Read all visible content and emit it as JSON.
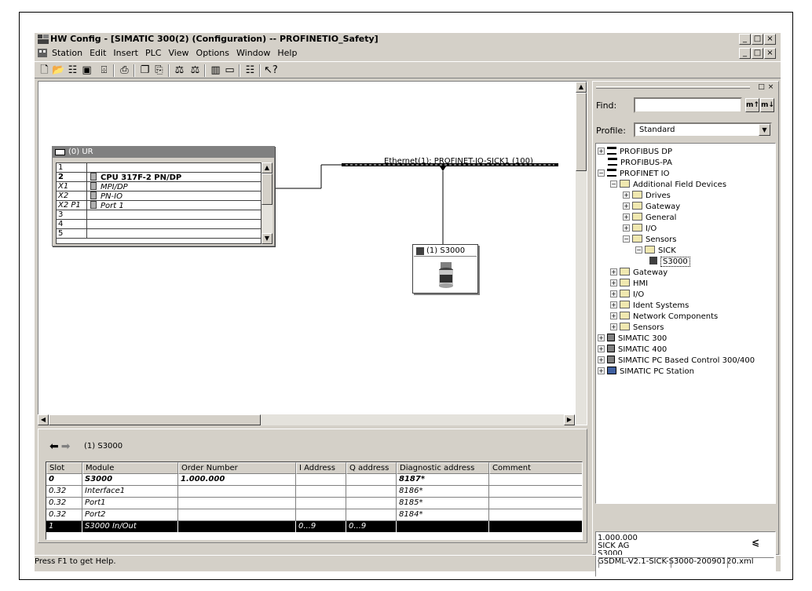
{
  "window": {
    "title": "HW Config - [SIMATIC 300(2) (Configuration) -- PROFINETIO_Safety]",
    "controls": [
      "_",
      "□",
      "×"
    ]
  },
  "menubar": [
    "Station",
    "Edit",
    "Insert",
    "PLC",
    "View",
    "Options",
    "Window",
    "Help"
  ],
  "toolbar": {
    "icons": [
      "new-icon",
      "open-icon",
      "save-compile-icon",
      "save-icon",
      "download-icon",
      "print-icon",
      "copy-icon",
      "paste-icon",
      "catalog-icon",
      "network-icon",
      "config-icon",
      "monitor-icon",
      "hardware-icon",
      "help-icon"
    ]
  },
  "rack": {
    "title": "(0) UR",
    "rows": [
      {
        "slot": "1",
        "module": "",
        "bold": false,
        "icon": false
      },
      {
        "slot": "2",
        "module": "CPU 317F-2 PN/DP",
        "bold": true,
        "icon": true
      },
      {
        "slot": "X1",
        "module": "MPI/DP",
        "bold": false,
        "icon": true
      },
      {
        "slot": "X2",
        "module": "PN-IO",
        "bold": false,
        "icon": true
      },
      {
        "slot": "X2 P1",
        "module": "Port 1",
        "bold": false,
        "icon": true
      },
      {
        "slot": "3",
        "module": "",
        "bold": false,
        "icon": false
      },
      {
        "slot": "4",
        "module": "",
        "bold": false,
        "icon": false
      },
      {
        "slot": "5",
        "module": "",
        "bold": false,
        "icon": false
      }
    ]
  },
  "network": {
    "label": "Ethernet(1): PROFINET-IO-SICK1 (100)"
  },
  "device": {
    "label": "(1) S3000"
  },
  "detail": {
    "title": "(1)   S3000",
    "columns": [
      "Slot",
      "Module",
      "Order Number",
      "I Address",
      "Q address",
      "Diagnostic address",
      "Comment"
    ],
    "rows": [
      {
        "slot": "0",
        "module": "S3000",
        "order": "1.000.000",
        "i": "",
        "q": "",
        "diag": "8187*",
        "comment": ""
      },
      {
        "slot": "0.32",
        "module": "Interface1",
        "order": "",
        "i": "",
        "q": "",
        "diag": "8186*",
        "comment": ""
      },
      {
        "slot": "0.32",
        "module": "Port1",
        "order": "",
        "i": "",
        "q": "",
        "diag": "8185*",
        "comment": ""
      },
      {
        "slot": "0.32",
        "module": "Port2",
        "order": "",
        "i": "",
        "q": "",
        "diag": "8184*",
        "comment": ""
      },
      {
        "slot": "1",
        "module": "S3000 In/Out",
        "order": "",
        "i": "0...9",
        "q": "0...9",
        "diag": "",
        "comment": ""
      }
    ]
  },
  "catalog": {
    "find_label": "Find:",
    "find_value": "",
    "find_buttons": [
      "m↑",
      "m↓"
    ],
    "profile_label": "Profile:",
    "profile_value": "Standard",
    "tree": [
      {
        "label": "PROFIBUS DP",
        "exp": "+",
        "icon": "net"
      },
      {
        "label": "PROFIBUS-PA",
        "exp": "",
        "icon": "net"
      },
      {
        "label": "PROFINET IO",
        "exp": "-",
        "icon": "net"
      },
      {
        "label": "Additional Field Devices",
        "exp": "-",
        "icon": "folder"
      },
      {
        "label": "Drives",
        "exp": "+",
        "icon": "folder"
      },
      {
        "label": "Gateway",
        "exp": "+",
        "icon": "folder"
      },
      {
        "label": "General",
        "exp": "+",
        "icon": "folder"
      },
      {
        "label": "I/O",
        "exp": "+",
        "icon": "folder"
      },
      {
        "label": "Sensors",
        "exp": "-",
        "icon": "folder"
      },
      {
        "label": "SICK",
        "exp": "-",
        "icon": "folder"
      },
      {
        "label": "S3000",
        "exp": "",
        "icon": "dev"
      },
      {
        "label": "Gateway",
        "exp": "+",
        "icon": "folder"
      },
      {
        "label": "HMI",
        "exp": "+",
        "icon": "folder"
      },
      {
        "label": "I/O",
        "exp": "+",
        "icon": "folder"
      },
      {
        "label": "Ident Systems",
        "exp": "+",
        "icon": "folder"
      },
      {
        "label": "Network Components",
        "exp": "+",
        "icon": "folder"
      },
      {
        "label": "Sensors",
        "exp": "+",
        "icon": "folder"
      },
      {
        "label": "SIMATIC 300",
        "exp": "+",
        "icon": "chip"
      },
      {
        "label": "SIMATIC 400",
        "exp": "+",
        "icon": "chip"
      },
      {
        "label": "SIMATIC PC Based Control 300/400",
        "exp": "+",
        "icon": "chip"
      },
      {
        "label": "SIMATIC PC Station",
        "exp": "+",
        "icon": "pc"
      }
    ],
    "info": [
      "1.000.000",
      "SICK AG",
      "S3000",
      "GSDML-V2.1-SICK-S3000-20090120.xml"
    ]
  },
  "status": {
    "text": "Press F1 to get Help."
  }
}
